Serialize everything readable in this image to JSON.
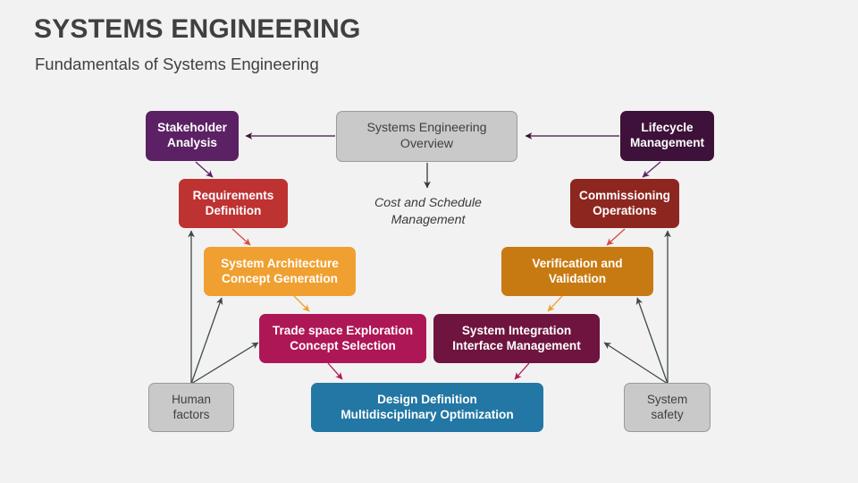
{
  "slide": {
    "title": "SYSTEMS ENGINEERING",
    "subtitle": "Fundamentals of Systems Engineering",
    "background_color": "#F2F2F2",
    "title_color": "#404040"
  },
  "diagram": {
    "type": "flow-diagram",
    "annotation": "Cost and Schedule\nManagement",
    "nodes": [
      {
        "id": "stakeholder-analysis",
        "label": "Stakeholder\nAnalysis",
        "color": "#5B2164",
        "text_color": "#FFFFFF"
      },
      {
        "id": "systems-engineering-overview",
        "label": "Systems Engineering\nOverview",
        "color": "#C9C9C9",
        "text_color": "#404040"
      },
      {
        "id": "lifecycle-management",
        "label": "Lifecycle\nManagement",
        "color": "#3D1139",
        "text_color": "#FFFFFF"
      },
      {
        "id": "requirements-definition",
        "label": "Requirements\nDefinition",
        "color": "#BE3232",
        "text_color": "#FFFFFF"
      },
      {
        "id": "commissioning-operations",
        "label": "Commissioning\nOperations",
        "color": "#8E2620",
        "text_color": "#FFFFFF"
      },
      {
        "id": "system-architecture",
        "label": "System Architecture\nConcept Generation",
        "color": "#F0A030",
        "text_color": "#FFFFFF"
      },
      {
        "id": "verification-validation",
        "label": "Verification and\nValidation",
        "color": "#C87A12",
        "text_color": "#FFFFFF"
      },
      {
        "id": "trade-space-exploration",
        "label": "Trade space Exploration\nConcept Selection",
        "color": "#AE1756",
        "text_color": "#FFFFFF"
      },
      {
        "id": "system-integration",
        "label": "System Integration\nInterface Management",
        "color": "#6E143F",
        "text_color": "#FFFFFF"
      },
      {
        "id": "human-factors",
        "label": "Human\nfactors",
        "color": "#C9C9C9",
        "text_color": "#404040"
      },
      {
        "id": "design-definition",
        "label": "Design Definition\nMultidisciplinary Optimization",
        "color": "#2377A4",
        "text_color": "#FFFFFF"
      },
      {
        "id": "system-safety",
        "label": "System\nsafety",
        "color": "#C9C9C9",
        "text_color": "#404040"
      }
    ],
    "edges": [
      {
        "from": "systems-engineering-overview",
        "to": "stakeholder-analysis",
        "color": "#3D1139"
      },
      {
        "from": "lifecycle-management",
        "to": "systems-engineering-overview",
        "color": "#3D1139"
      },
      {
        "from": "systems-engineering-overview",
        "to": "cost-and-schedule-note",
        "color": "#3A3A3A"
      },
      {
        "from": "stakeholder-analysis",
        "to": "requirements-definition",
        "color": "#5B2164"
      },
      {
        "from": "lifecycle-management",
        "to": "commissioning-operations",
        "color": "#5B2164"
      },
      {
        "from": "requirements-definition",
        "to": "system-architecture",
        "color": "#D94A44"
      },
      {
        "from": "commissioning-operations",
        "to": "verification-validation",
        "color": "#D94A44"
      },
      {
        "from": "system-architecture",
        "to": "trade-space-exploration",
        "color": "#F0A030"
      },
      {
        "from": "verification-validation",
        "to": "system-integration",
        "color": "#F0A030"
      },
      {
        "from": "trade-space-exploration",
        "to": "design-definition",
        "color": "#AE1756"
      },
      {
        "from": "system-integration",
        "to": "design-definition",
        "color": "#AE1756"
      },
      {
        "from": "human-factors",
        "to": "requirements-definition",
        "color": "#3F4A4A"
      },
      {
        "from": "human-factors",
        "to": "system-architecture",
        "color": "#3F4A4A"
      },
      {
        "from": "human-factors",
        "to": "trade-space-exploration",
        "color": "#3F4A4A"
      },
      {
        "from": "system-safety",
        "to": "commissioning-operations",
        "color": "#3F4A4A"
      },
      {
        "from": "system-safety",
        "to": "verification-validation",
        "color": "#3F4A4A"
      },
      {
        "from": "system-safety",
        "to": "system-integration",
        "color": "#3F4A4A"
      }
    ]
  }
}
